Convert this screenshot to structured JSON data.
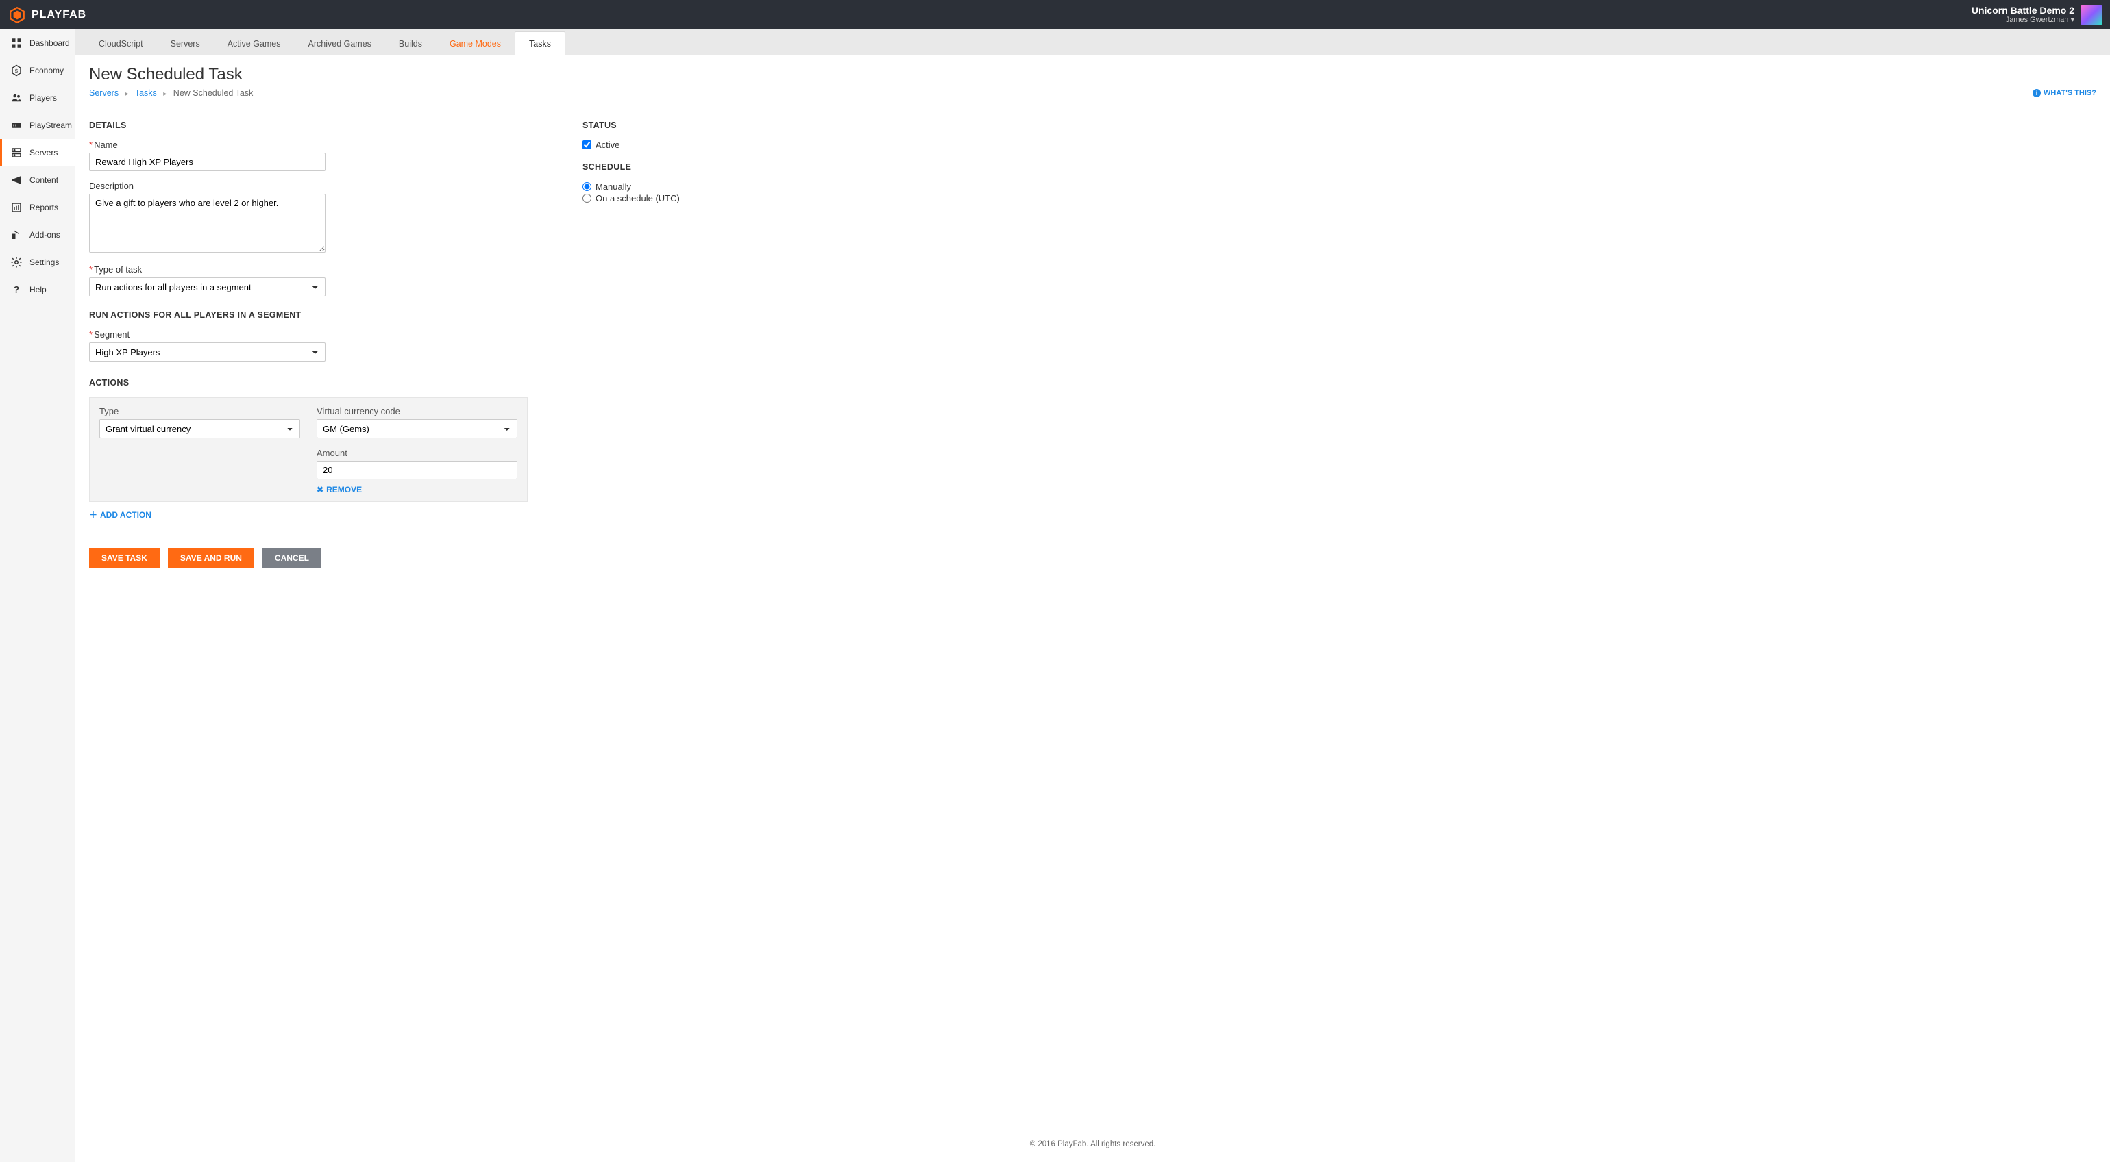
{
  "header": {
    "brand": "PLAYFAB",
    "game_title": "Unicorn Battle Demo 2",
    "user_name": "James Gwertzman"
  },
  "sidebar": {
    "items": [
      {
        "label": "Dashboard",
        "icon": "dashboard-icon"
      },
      {
        "label": "Economy",
        "icon": "economy-icon"
      },
      {
        "label": "Players",
        "icon": "players-icon"
      },
      {
        "label": "PlayStream",
        "icon": "playstream-icon"
      },
      {
        "label": "Servers",
        "icon": "servers-icon",
        "active": true
      },
      {
        "label": "Content",
        "icon": "content-icon"
      },
      {
        "label": "Reports",
        "icon": "reports-icon"
      },
      {
        "label": "Add-ons",
        "icon": "addons-icon"
      },
      {
        "label": "Settings",
        "icon": "settings-icon"
      },
      {
        "label": "Help",
        "icon": "help-icon"
      }
    ]
  },
  "tabs": {
    "items": [
      {
        "label": "CloudScript"
      },
      {
        "label": "Servers"
      },
      {
        "label": "Active Games"
      },
      {
        "label": "Archived Games"
      },
      {
        "label": "Builds"
      },
      {
        "label": "Game Modes",
        "highlight": true
      },
      {
        "label": "Tasks",
        "active": true
      }
    ]
  },
  "page": {
    "title": "New Scheduled Task",
    "breadcrumbs": {
      "a": "Servers",
      "b": "Tasks",
      "c": "New Scheduled Task"
    },
    "whats_this": "WHAT'S THIS?"
  },
  "details": {
    "heading": "DETAILS",
    "name_label": "Name",
    "name_value": "Reward High XP Players",
    "desc_label": "Description",
    "desc_value": "Give a gift to players who are level 2 or higher.",
    "type_label": "Type of task",
    "type_value": "Run actions for all players in a segment",
    "segment_heading": "RUN ACTIONS FOR ALL PLAYERS IN A SEGMENT",
    "segment_label": "Segment",
    "segment_value": "High XP Players"
  },
  "actions": {
    "heading": "ACTIONS",
    "type_label": "Type",
    "type_value": "Grant virtual currency",
    "vc_label": "Virtual currency code",
    "vc_value": "GM (Gems)",
    "amount_label": "Amount",
    "amount_value": "20",
    "remove_label": "REMOVE",
    "add_label": "ADD ACTION"
  },
  "buttons": {
    "save": "SAVE TASK",
    "saverun": "SAVE AND RUN",
    "cancel": "CANCEL"
  },
  "status": {
    "heading": "STATUS",
    "active_label": "Active",
    "schedule_heading": "SCHEDULE",
    "manual_label": "Manually",
    "sched_label": "On a schedule (UTC)"
  },
  "footer": "© 2016 PlayFab. All rights reserved."
}
